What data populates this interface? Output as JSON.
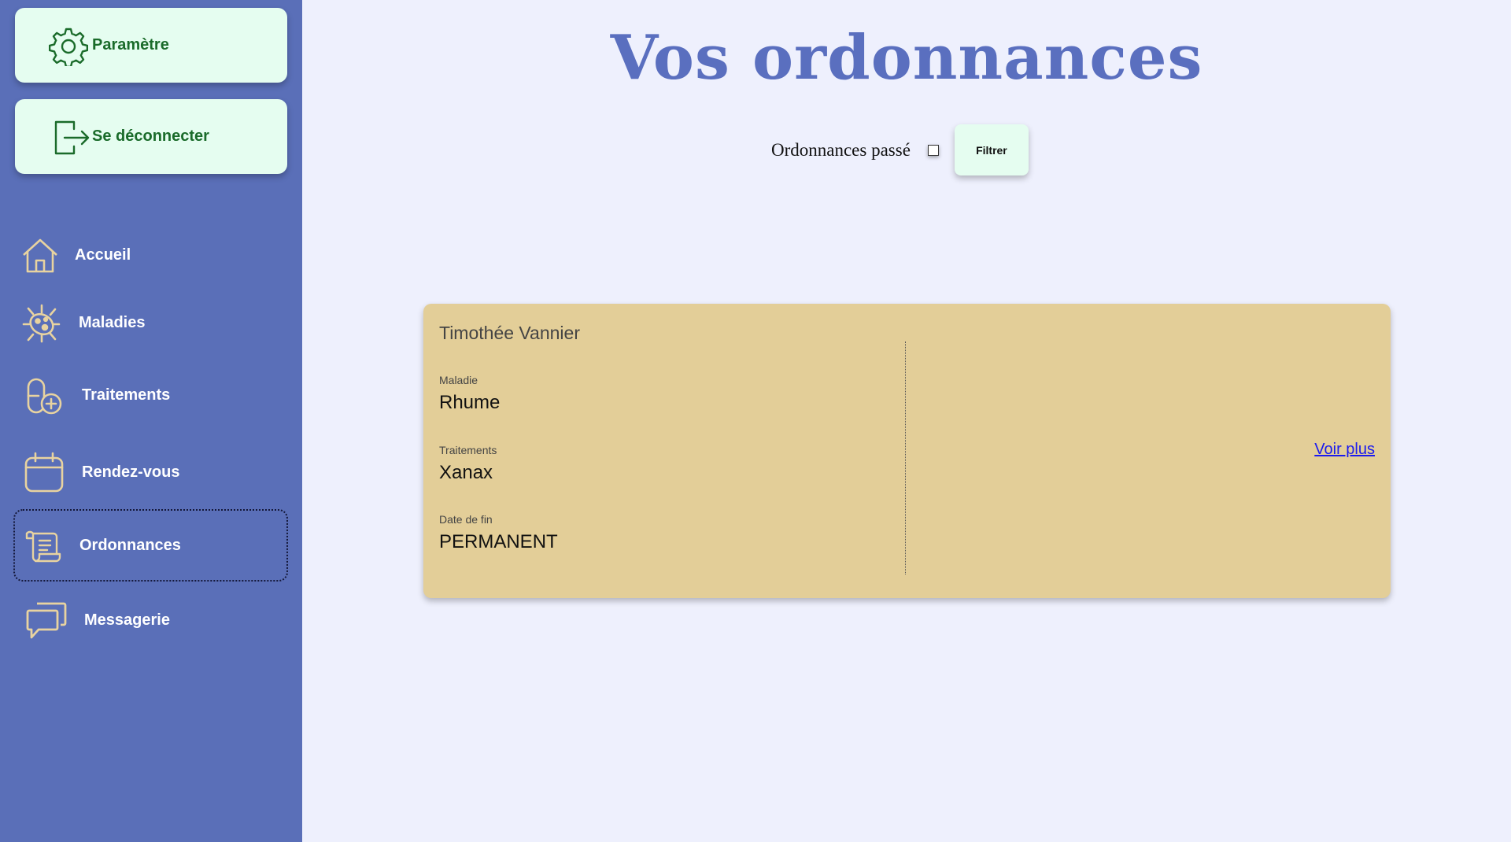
{
  "sidebar": {
    "settings_label": "Paramètre",
    "logout_label": "Se déconnecter",
    "items": [
      {
        "label": "Accueil",
        "icon": "home-icon"
      },
      {
        "label": "Maladies",
        "icon": "virus-icon"
      },
      {
        "label": "Traitements",
        "icon": "pill-icon"
      },
      {
        "label": "Rendez-vous",
        "icon": "calendar-icon"
      },
      {
        "label": "Ordonnances",
        "icon": "scroll-icon",
        "active": true
      },
      {
        "label": "Messagerie",
        "icon": "chat-icon"
      }
    ]
  },
  "main": {
    "title": "Vos ordonnances",
    "filter": {
      "label": "Ordonnances passé",
      "checked": false,
      "button_label": "Filtrer"
    },
    "prescriptions": [
      {
        "patient": "Timothée Vannier",
        "disease_label": "Maladie",
        "disease": "Rhume",
        "treatments_label": "Traitements",
        "treatments": "Xanax",
        "end_date_label": "Date de fin",
        "end_date": "PERMANENT",
        "more_link": "Voir plus"
      }
    ]
  },
  "colors": {
    "sidebar_bg": "#5a6fb8",
    "page_bg": "#eef0fd",
    "button_bg": "#e5fdf0",
    "button_text": "#1a6b2a",
    "title": "#5a6fbf",
    "card_bg": "#e3ce98",
    "nav_icon": "#e8d3a0"
  }
}
